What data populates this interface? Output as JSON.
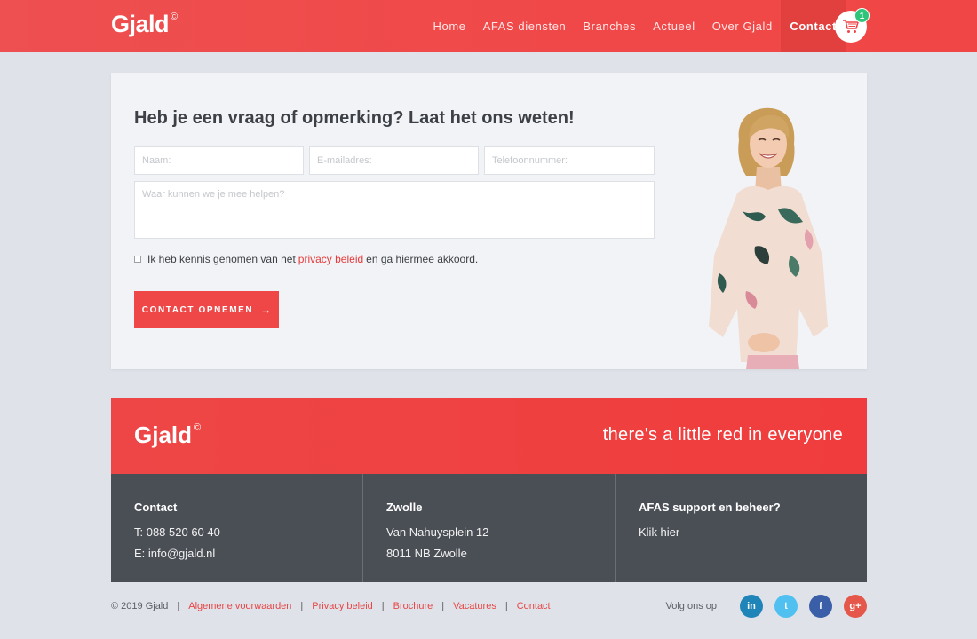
{
  "header": {
    "brand": "Gjald",
    "brand_mark": "©",
    "nav": [
      {
        "label": "Home"
      },
      {
        "label": "AFAS diensten"
      },
      {
        "label": "Branches"
      },
      {
        "label": "Actueel"
      },
      {
        "label": "Over Gjald"
      },
      {
        "label": "Contact",
        "active": true
      }
    ],
    "cart_count": "1",
    "cart_icon": "shopping-cart-icon"
  },
  "contact_form": {
    "title": "Heb je een vraag of opmerking? Laat het ons weten!",
    "name_placeholder": "Naam:",
    "email_placeholder": "E-mailadres:",
    "phone_placeholder": "Telefoonnummer:",
    "message_placeholder": "Waar kunnen we je mee helpen?",
    "consent_before": "Ik heb kennis genomen van het",
    "consent_link": "privacy beleid",
    "consent_after": "en ga hiermee akkoord.",
    "submit_label": "CONTACT OPNEMEN",
    "submit_arrow": "→"
  },
  "footer": {
    "brand": "Gjald",
    "brand_mark": "©",
    "tagline": "there's a little red in everyone",
    "columns": [
      {
        "title": "Contact",
        "lines": [
          "T: 088 520 60 40",
          "E: info@gjald.nl"
        ]
      },
      {
        "title": "Zwolle",
        "lines": [
          "Van Nahuysplein 12",
          "8011 NB Zwolle"
        ]
      },
      {
        "title": "AFAS support en beheer?",
        "lines": [
          "Klik hier"
        ]
      }
    ],
    "copyright": "© 2019 Gjald",
    "links": [
      "Algemene voorwaarden",
      "Privacy beleid",
      "Brochure",
      "Vacatures",
      "Contact"
    ],
    "separator": "|",
    "follow_label": "Volg ons op",
    "social": [
      {
        "icon": "linkedin-icon",
        "glyph": "in",
        "color": "#1f84b8"
      },
      {
        "icon": "twitter-icon",
        "glyph": "t",
        "color": "#4fc0ef"
      },
      {
        "icon": "facebook-icon",
        "glyph": "f",
        "color": "#3b5ea8"
      },
      {
        "icon": "google-plus-icon",
        "glyph": "g+",
        "color": "#e4574a"
      }
    ]
  },
  "colors": {
    "brand_red": "#ef4747",
    "footer_dark": "#4a4e55",
    "background": "#dfe2e8"
  }
}
